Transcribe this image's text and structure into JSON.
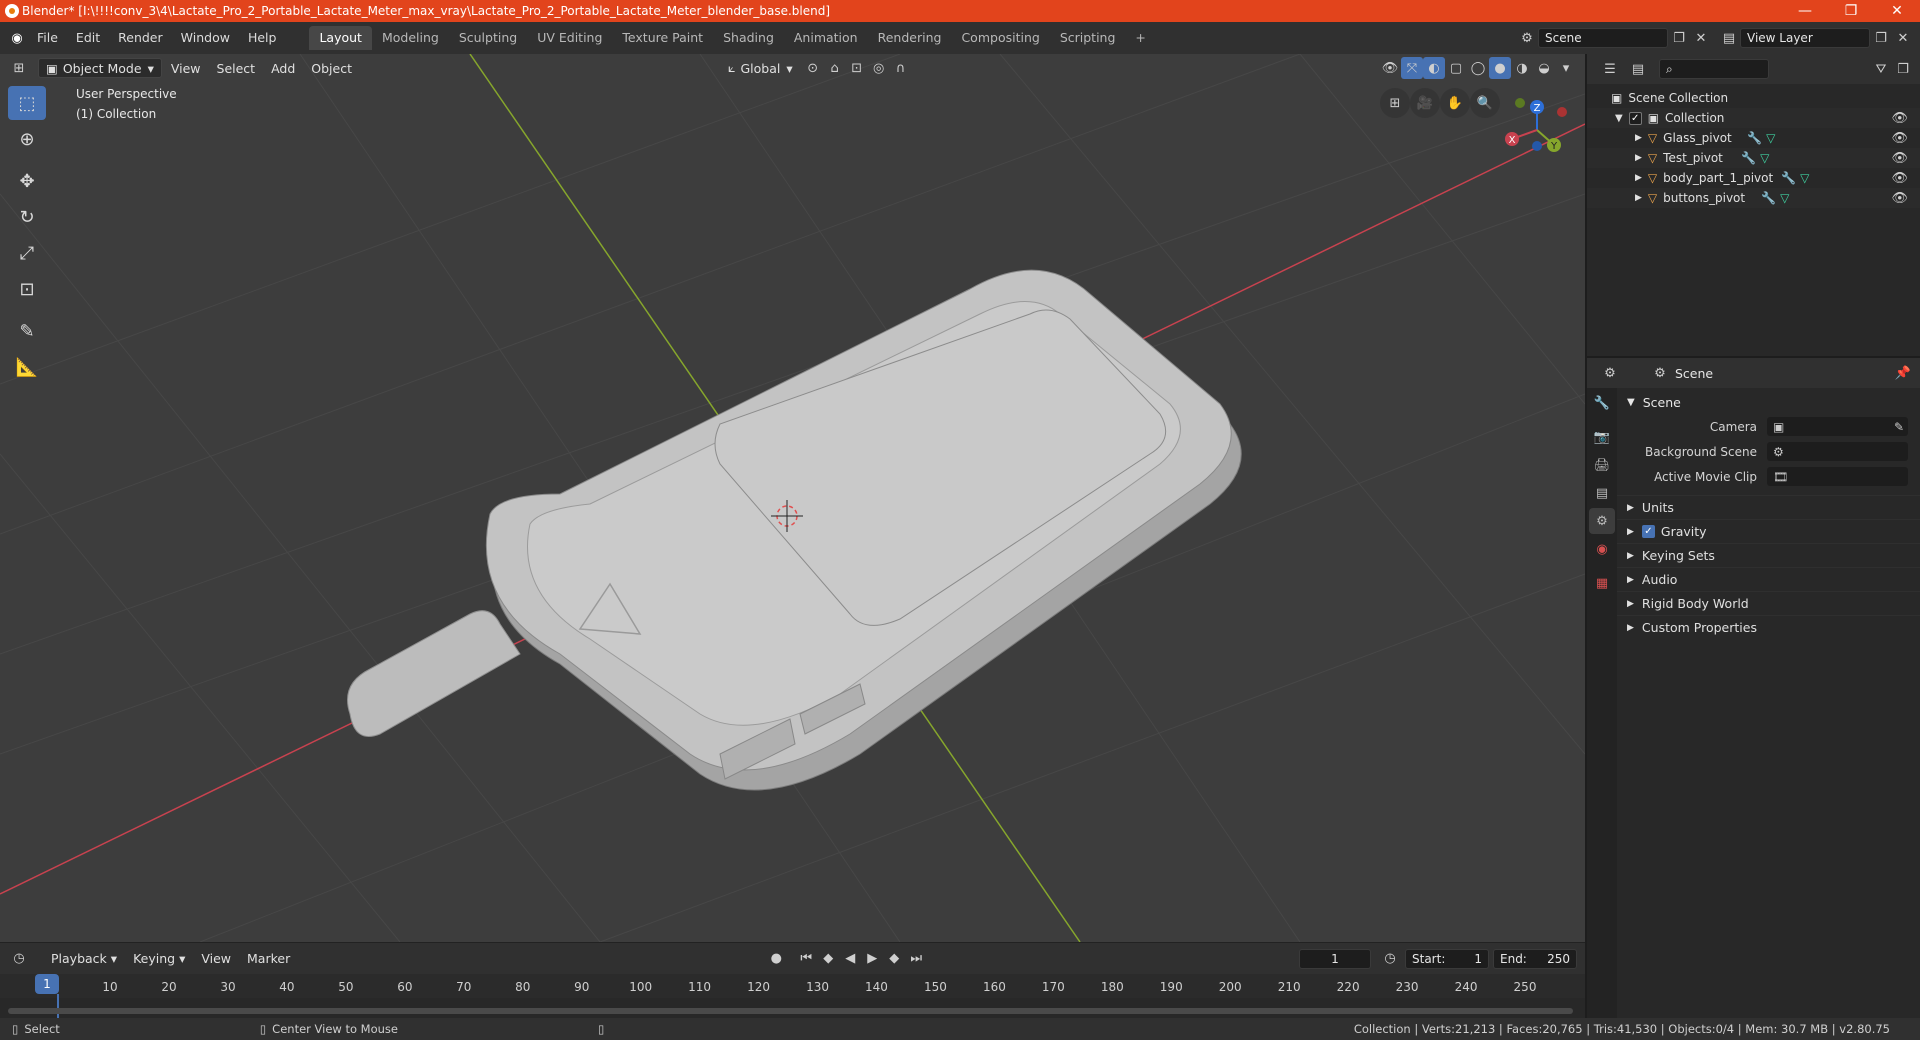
{
  "window": {
    "title": "Blender* [I:\\!!!!conv_3\\4\\Lactate_Pro_2_Portable_Lactate_Meter_max_vray\\Lactate_Pro_2_Portable_Lactate_Meter_blender_base.blend]",
    "minimize": "—",
    "maximize": "❐",
    "close": "✕"
  },
  "menus": [
    "File",
    "Edit",
    "Render",
    "Window",
    "Help"
  ],
  "workspaces": [
    "Layout",
    "Modeling",
    "Sculpting",
    "UV Editing",
    "Texture Paint",
    "Shading",
    "Animation",
    "Rendering",
    "Compositing",
    "Scripting"
  ],
  "workspace_add": "+",
  "scene_field": "Scene",
  "view_layer_field": "View Layer",
  "viewport": {
    "mode": "Object Mode",
    "menu": [
      "View",
      "Select",
      "Add",
      "Object"
    ],
    "transform": "Global",
    "info_line1": "User Perspective",
    "info_line2": "(1) Collection"
  },
  "gizmo": {
    "x": "X",
    "y": "Y",
    "z": "Z"
  },
  "outliner": {
    "search_placeholder": "",
    "root": "Scene Collection",
    "collection": "Collection",
    "items": [
      "Glass_pivot",
      "Test_pivot",
      "body_part_1_pivot",
      "buttons_pivot"
    ]
  },
  "properties": {
    "header_title": "Scene",
    "panel": "Scene",
    "camera_label": "Camera",
    "camera_value": "",
    "bg_scene_label": "Background Scene",
    "bg_scene_value": "",
    "movie_clip_label": "Active Movie Clip",
    "movie_clip_value": "",
    "sub_panels": [
      "Units",
      "Gravity",
      "Keying Sets",
      "Audio",
      "Rigid Body World",
      "Custom Properties"
    ]
  },
  "timeline": {
    "menu": [
      "Playback",
      "Keying",
      "View",
      "Marker"
    ],
    "current_frame": "1",
    "start_label": "Start:",
    "start": "1",
    "end_label": "End:",
    "end": "250",
    "ticks": [
      "1",
      "10",
      "20",
      "30",
      "40",
      "50",
      "60",
      "70",
      "80",
      "90",
      "100",
      "110",
      "120",
      "130",
      "140",
      "150",
      "160",
      "170",
      "180",
      "190",
      "200",
      "210",
      "220",
      "230",
      "240",
      "250"
    ]
  },
  "status": {
    "left1": "Select",
    "left2": "Center View to Mouse",
    "right": "Collection | Verts:21,213 | Faces:20,765 | Tris:41,530 | Objects:0/4 | Mem: 30.7 MB | v2.80.75"
  },
  "colors": {
    "titlebar": "#e2441c",
    "accent": "#4772b3",
    "viewport_bg": "#3d3d3d",
    "axis_x": "#c8424f",
    "axis_y": "#86a62c",
    "object": "#bdbdbd"
  }
}
